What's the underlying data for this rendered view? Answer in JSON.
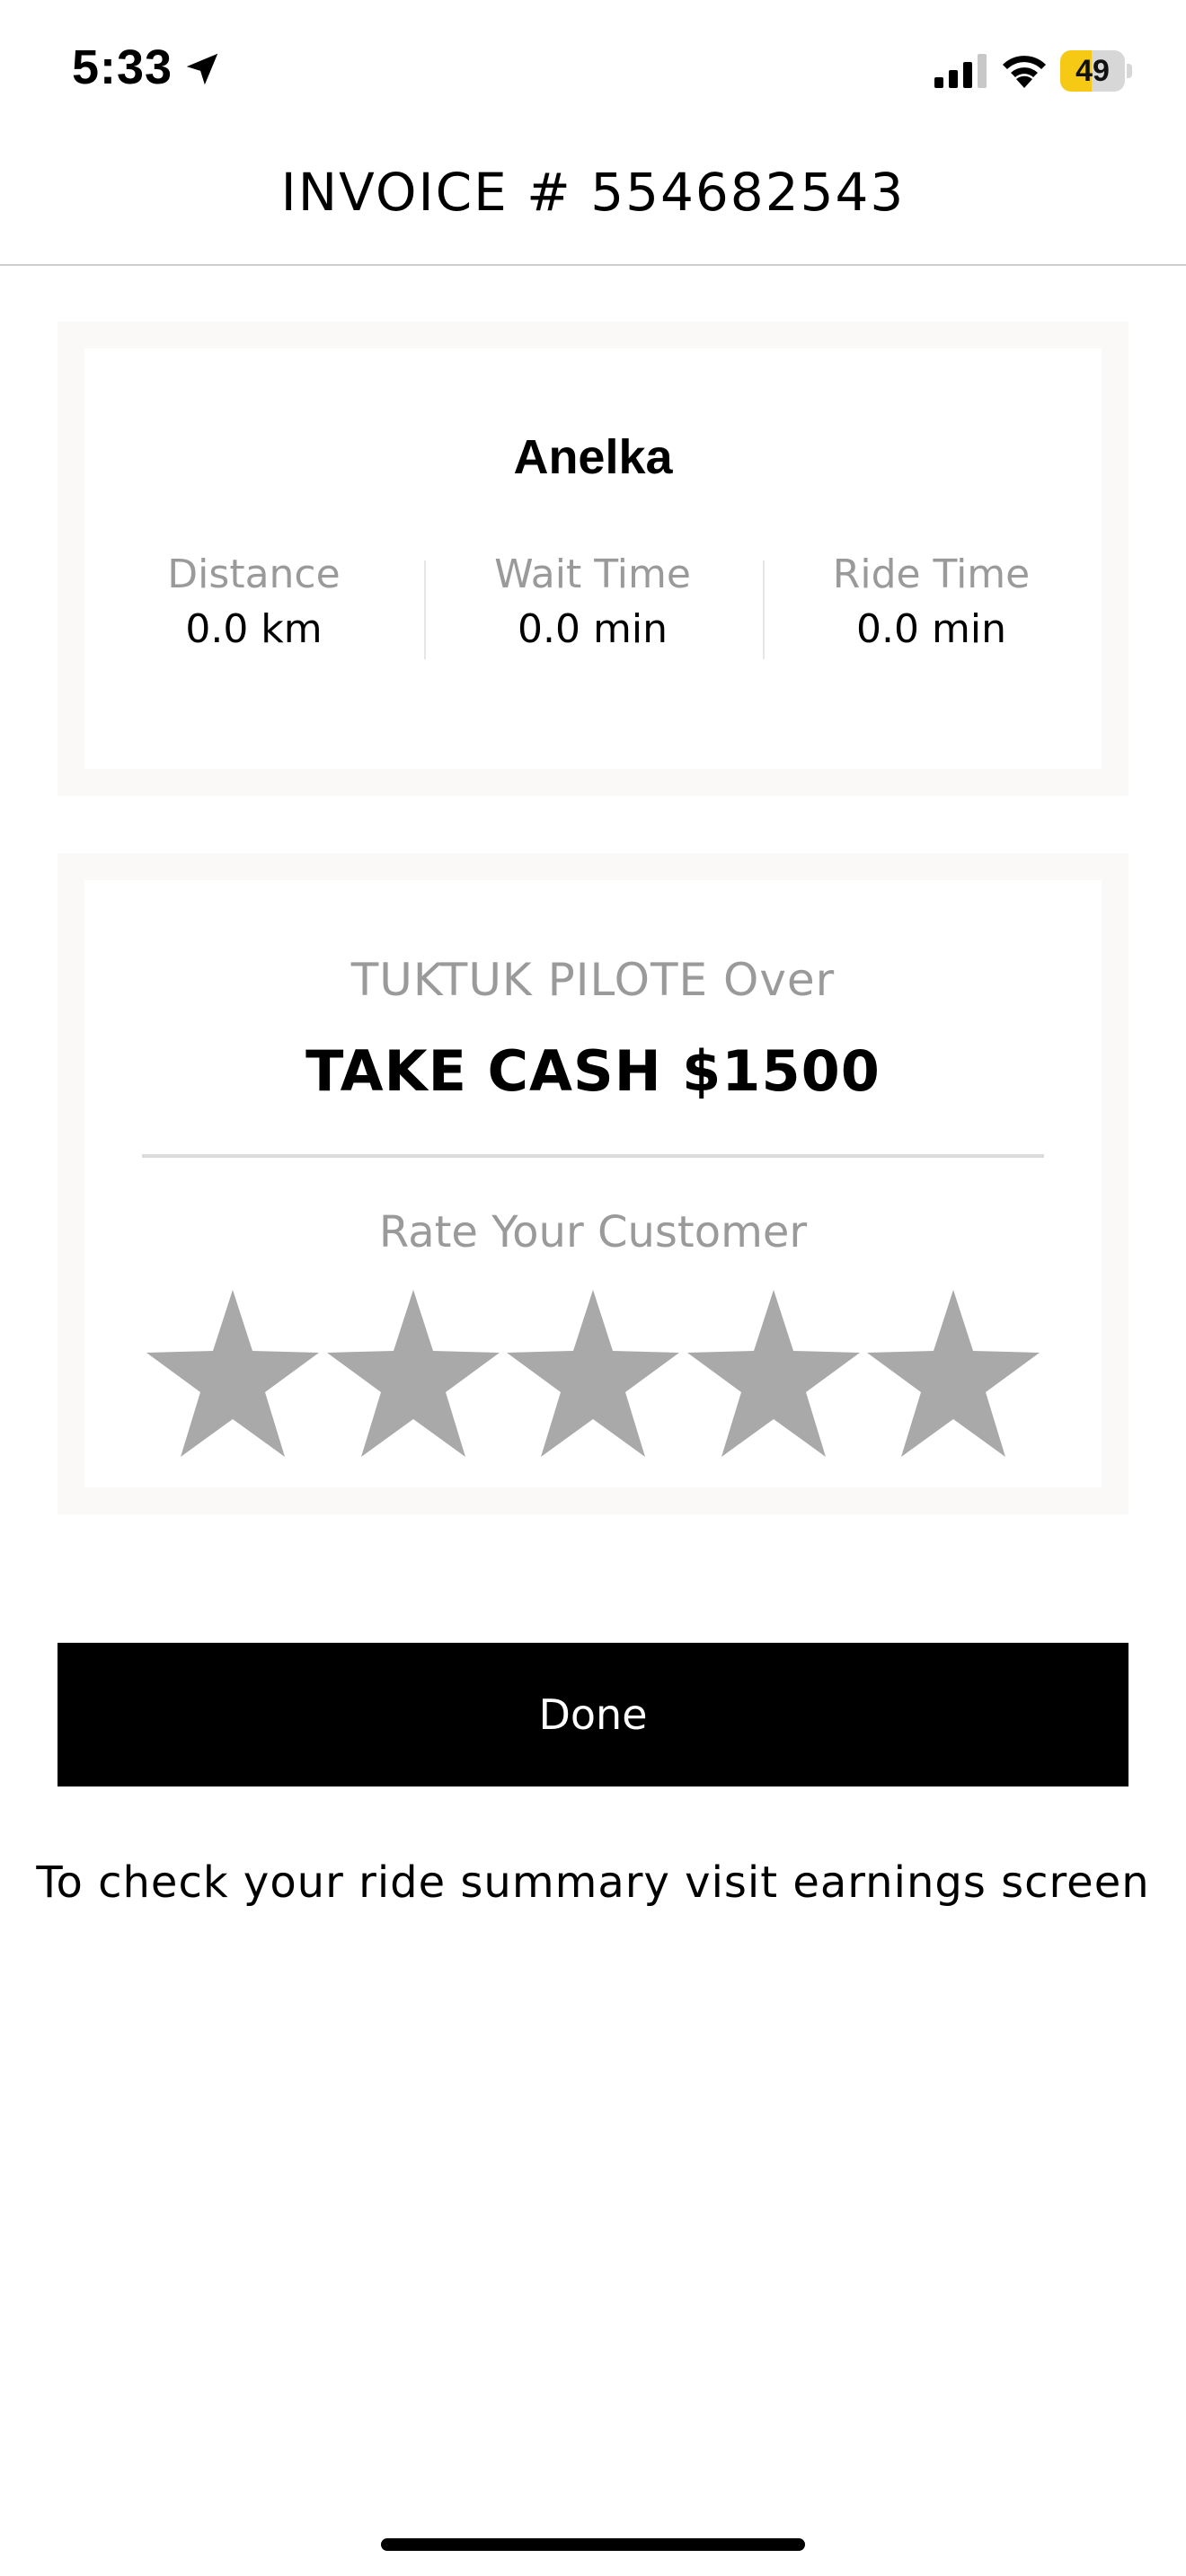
{
  "status_bar": {
    "time": "5:33",
    "battery_level": "49",
    "battery_fraction": 0.49,
    "battery_fill_color": "#f6c915",
    "icons": [
      "location-arrow-icon",
      "cellular-signal-icon",
      "wifi-icon",
      "battery-icon"
    ]
  },
  "header": {
    "title": "INVOICE # 554682543"
  },
  "trip": {
    "customer_name": "Anelka",
    "metrics": [
      {
        "label": "Distance",
        "value": "0.0 km"
      },
      {
        "label": "Wait Time",
        "value": "0.0 min"
      },
      {
        "label": "Ride Time",
        "value": "0.0 min"
      }
    ]
  },
  "payment": {
    "provider_line": "TUKTUK PILOTE Over",
    "cash_line": "TAKE CASH $1500",
    "rate_label": "Rate Your Customer",
    "rating": {
      "max": 5,
      "value": 0,
      "star_color": "#a9a9a9"
    }
  },
  "actions": {
    "done_label": "Done"
  },
  "footer": {
    "note": "To check your ride summary visit earnings screen"
  },
  "colors": {
    "card_outer": "#fbf8f8",
    "muted_text": "#9a9a9a",
    "button_bg": "#000000",
    "button_text": "#ffffff"
  }
}
